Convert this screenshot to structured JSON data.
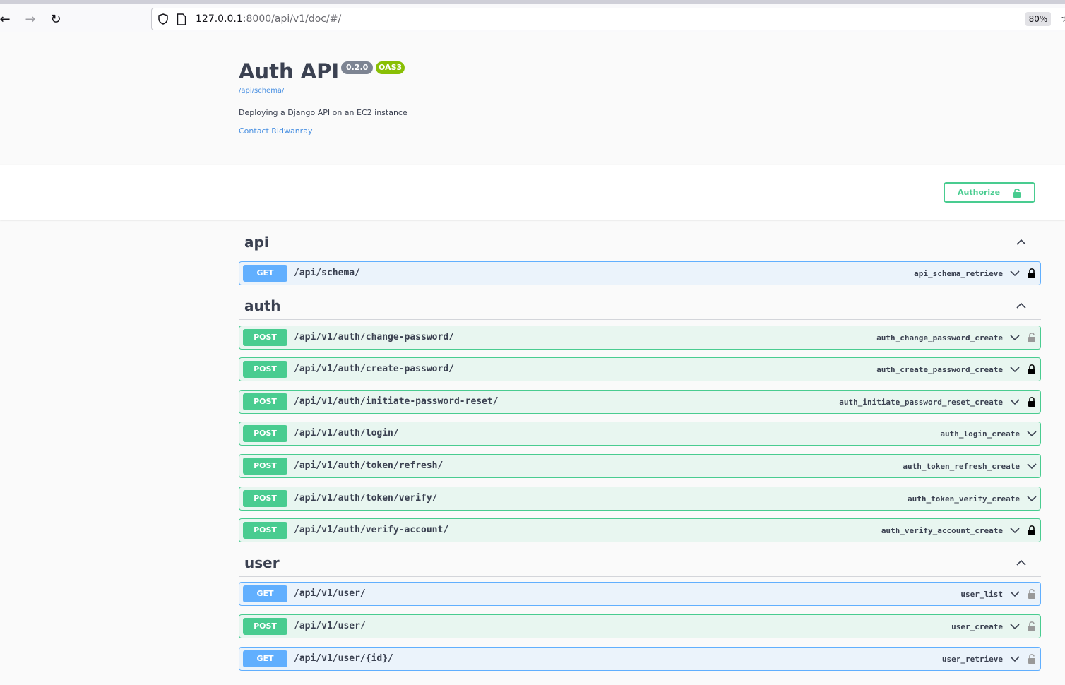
{
  "browser": {
    "back_icon": "arrow-left-icon",
    "forward_icon": "arrow-right-icon",
    "reload_icon": "reload-icon",
    "url_host": "127.0.0.1",
    "url_rest": ":8000/api/v1/doc/#/",
    "zoom": "80%"
  },
  "info": {
    "title": "Auth API",
    "version": "0.2.0",
    "oas": "OAS3",
    "schema_url": "/api/schema/",
    "description": "Deploying a Django API on an EC2 instance",
    "contact": "Contact Ridwanray"
  },
  "authorize_label": "Authorize",
  "colors": {
    "get": "#61affe",
    "post": "#49cc90",
    "lock_locked": "#000000",
    "lock_unlocked": "#999999"
  },
  "tags": [
    {
      "name": "api",
      "operations": [
        {
          "method": "GET",
          "path": "/api/schema/",
          "operation_id": "api_schema_retrieve",
          "lock": "locked"
        }
      ]
    },
    {
      "name": "auth",
      "operations": [
        {
          "method": "POST",
          "path": "/api/v1/auth/change-password/",
          "operation_id": "auth_change_password_create",
          "lock": "unlocked"
        },
        {
          "method": "POST",
          "path": "/api/v1/auth/create-password/",
          "operation_id": "auth_create_password_create",
          "lock": "locked"
        },
        {
          "method": "POST",
          "path": "/api/v1/auth/initiate-password-reset/",
          "operation_id": "auth_initiate_password_reset_create",
          "lock": "locked"
        },
        {
          "method": "POST",
          "path": "/api/v1/auth/login/",
          "operation_id": "auth_login_create",
          "lock": "none"
        },
        {
          "method": "POST",
          "path": "/api/v1/auth/token/refresh/",
          "operation_id": "auth_token_refresh_create",
          "lock": "none"
        },
        {
          "method": "POST",
          "path": "/api/v1/auth/token/verify/",
          "operation_id": "auth_token_verify_create",
          "lock": "none"
        },
        {
          "method": "POST",
          "path": "/api/v1/auth/verify-account/",
          "operation_id": "auth_verify_account_create",
          "lock": "locked"
        }
      ]
    },
    {
      "name": "user",
      "operations": [
        {
          "method": "GET",
          "path": "/api/v1/user/",
          "operation_id": "user_list",
          "lock": "unlocked"
        },
        {
          "method": "POST",
          "path": "/api/v1/user/",
          "operation_id": "user_create",
          "lock": "unlocked"
        },
        {
          "method": "GET",
          "path": "/api/v1/user/{id}/",
          "operation_id": "user_retrieve",
          "lock": "unlocked"
        }
      ]
    }
  ]
}
